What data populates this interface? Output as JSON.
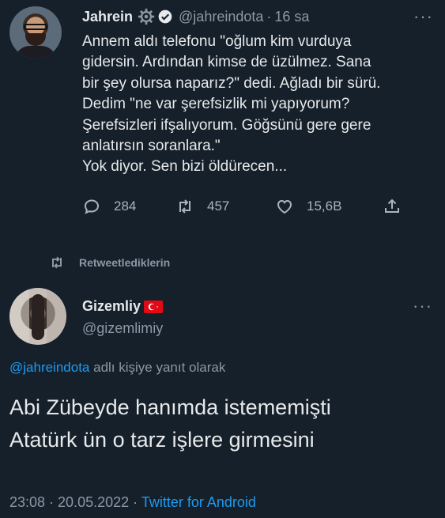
{
  "tweet": {
    "author_name": "Jahrein",
    "handle": "@jahreindota",
    "separator": "·",
    "time": "16 sa",
    "more": "···",
    "text_lines": [
      "Annem aldı telefonu \"oğlum kim vurduya",
      "gidersin. Ardından kimse de üzülmez. Sana",
      "bir şey olursa naparız?\" dedi. Ağladı bir sürü.",
      "Dedim \"ne var şerefsizlik mi yapıyorum?",
      "Şerefsizleri ifşalıyorum. Göğsünü gere gere",
      "anlatırsın soranlara.\"",
      "Yok diyor. Sen bizi öldürecen..."
    ],
    "stats": {
      "replies": "284",
      "retweets": "457",
      "likes": "15,6B"
    }
  },
  "retweet_label": "Retweetlediklerin",
  "reply": {
    "author_name": "Gizemliy",
    "handle": "@gizemlimiy",
    "more": "···",
    "replying_mention": "@jahreindota",
    "replying_text": " adlı kişiye yanıt olarak",
    "text_lines": [
      "Abi Zübeyde hanımda istememişti",
      "Atatürk ün o tarz işlere girmesini"
    ],
    "timestamp": "23:08 · 20.05.2022 · ",
    "source": "Twitter for Android"
  },
  "colors": {
    "background": "#15202b",
    "text": "#e7e9ea",
    "secondary": "#8b98a5",
    "link": "#1d9bf0",
    "flag": "#e30a17"
  },
  "icons": [
    "gear-icon",
    "verified-icon",
    "reply-icon",
    "retweet-icon",
    "like-icon",
    "share-icon",
    "turkey-flag-icon"
  ]
}
